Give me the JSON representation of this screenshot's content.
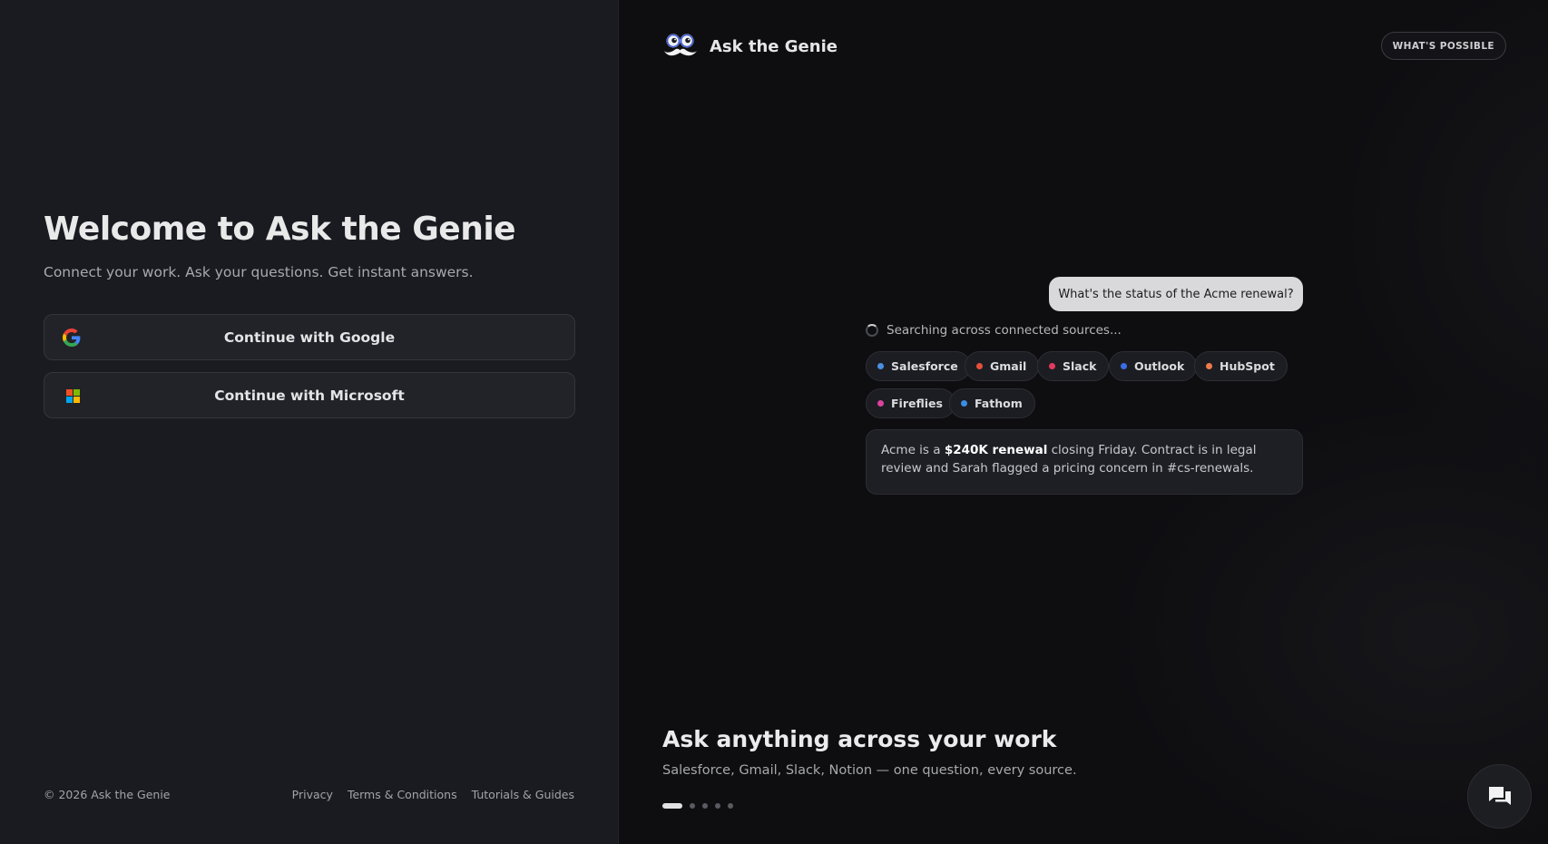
{
  "left": {
    "title": "Welcome to Ask the Genie",
    "subtitle": "Connect your work. Ask your questions. Get instant answers.",
    "google_button": "Continue with Google",
    "microsoft_button": "Continue with Microsoft",
    "footer": {
      "copyright": "© 2026 Ask the Genie",
      "links": [
        "Privacy",
        "Terms & Conditions",
        "Tutorials & Guides"
      ]
    }
  },
  "right": {
    "brand_name": "Ask the Genie",
    "whats_possible": "WHAT'S POSSIBLE",
    "demo": {
      "question": "What's the status of the Acme renewal?",
      "searching": "Searching across connected sources...",
      "sources": [
        {
          "name": "Salesforce",
          "color": "#4a90e2"
        },
        {
          "name": "Gmail",
          "color": "#e2513a"
        },
        {
          "name": "Slack",
          "color": "#e23a5e"
        },
        {
          "name": "Outlook",
          "color": "#3a6ee2"
        },
        {
          "name": "HubSpot",
          "color": "#ef7a4a"
        },
        {
          "name": "Fireflies",
          "color": "#d9449c"
        },
        {
          "name": "Fathom",
          "color": "#3a8ee2"
        }
      ],
      "answer_prefix": "Acme is a ",
      "answer_bold": "$240K renewal",
      "answer_suffix": " closing Friday. Contract is in legal review and Sarah flagged a pricing concern in #cs-renewals."
    },
    "hero_title": "Ask anything across your work",
    "hero_subtitle": "Salesforce, Gmail, Slack, Notion — one question, every source.",
    "carousel": {
      "total": 5,
      "active_index": 0
    }
  },
  "icons": {
    "google": "google-g-icon",
    "microsoft": "microsoft-logo-icon",
    "brand": "genie-mascot-icon",
    "chat": "chat-bubbles-icon",
    "spinner": "loading-spinner-icon"
  }
}
